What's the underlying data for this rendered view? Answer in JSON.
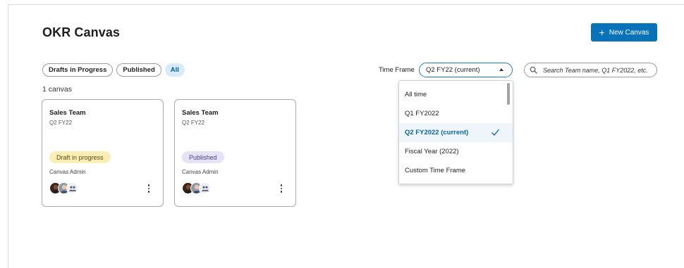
{
  "header": {
    "title": "OKR Canvas",
    "new_canvas_label": "New Canvas",
    "new_canvas_icon": "plus-icon"
  },
  "filters": {
    "chips": [
      {
        "label": "Drafts in Progress"
      },
      {
        "label": "Published"
      },
      {
        "label": "All",
        "active": true
      }
    ]
  },
  "canvas_count": "1 canvas",
  "cards": [
    {
      "team": "Sales Team",
      "period": "Q2 FY22",
      "status": "Draft in progress",
      "role": "Canvas Admin"
    },
    {
      "team": "Sales Team",
      "period": "Q2 FY22",
      "status": "Published",
      "role": "Canvas Admin"
    }
  ],
  "time_frame": {
    "label": "Time Frame",
    "selected": "Q2 FY22 (current)",
    "options": [
      {
        "label": "All time"
      },
      {
        "label": "Q1 FY2022"
      },
      {
        "label": "Q2 FY2022 (current)",
        "selected": true
      },
      {
        "label": "Fiscal Year (2022)"
      },
      {
        "label": "Custom Time Frame"
      }
    ]
  },
  "search": {
    "placeholder": "Search Team name, Q1 FY2022, etc.",
    "icon": "search-icon"
  },
  "colors": {
    "primary": "#0a72b8",
    "active_chip_bg": "#d7ebfa",
    "draft_badge": "#fdeeb5",
    "published_badge": "#e6e2f7",
    "selected_option_text": "#0a64a6"
  }
}
